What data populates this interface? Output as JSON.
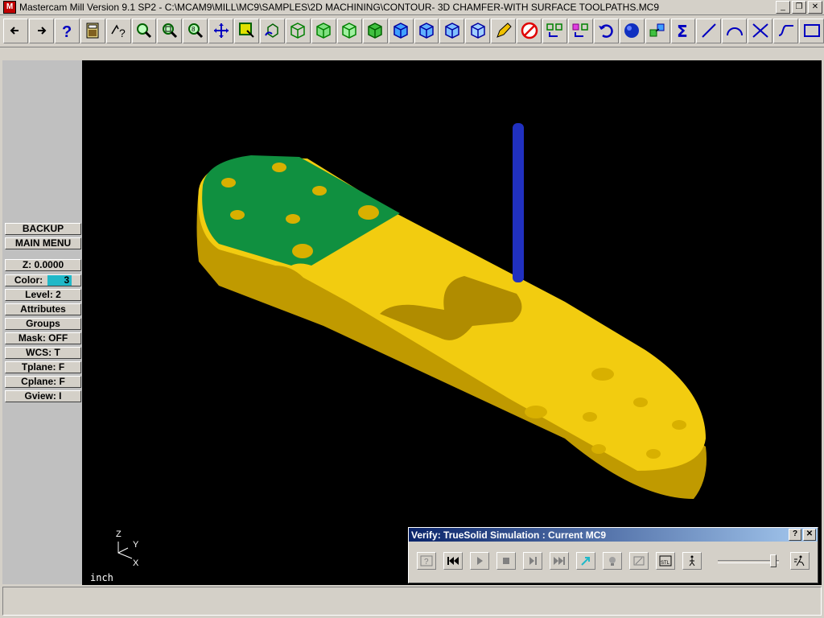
{
  "window": {
    "title": "Mastercam Mill Version 9.1 SP2 - C:\\MCAM9\\MILL\\MC9\\SAMPLES\\2D MACHINING\\CONTOUR- 3D CHAMFER-WITH SURFACE TOOLPATHS.MC9",
    "minimize": "_",
    "restore": "❐",
    "close": "✕"
  },
  "toolbar": {
    "items": [
      "back-arrow",
      "forward-arrow",
      "help",
      "calculator",
      "analyze",
      "zoom",
      "zoom-window",
      "zoom-out",
      "pan",
      "select",
      "rotate",
      "view-top",
      "view-front",
      "view-side",
      "view-iso",
      "view-solid1",
      "view-solid2",
      "view-solid3",
      "view-solid4",
      "pencil",
      "no-entry",
      "transform-1",
      "transform-2",
      "undo",
      "shade-sphere",
      "group",
      "sum",
      "line",
      "arc",
      "fillet",
      "spline",
      "rectangle"
    ]
  },
  "left_menu": {
    "backup": "BACKUP",
    "main_menu": "MAIN MENU",
    "z_value": "Z:  0.0000",
    "color_label": "Color:",
    "color_value": "3",
    "level": "Level:  2",
    "attributes": "Attributes",
    "groups": "Groups",
    "mask": "Mask:  OFF",
    "wcs": "WCS:   T",
    "tplane": "Tplane:  F",
    "cplane": "Cplane:  F",
    "gview": "Gview:   I"
  },
  "viewport": {
    "units": "inch",
    "axis_z": "Z",
    "axis_y": "Y",
    "axis_x": "X"
  },
  "verify": {
    "title": "Verify: TrueSolid Simulation : Current MC9",
    "help": "?",
    "close": "✕",
    "tools": [
      "options",
      "rewind",
      "play",
      "stop",
      "step",
      "fast-forward",
      "tool-display",
      "light-bulb",
      "zoom-part",
      "stl-save",
      "walk"
    ],
    "speed_slider": 0.9
  },
  "colors": {
    "part_yellow": "#f0c800",
    "part_shadow": "#c09a00",
    "top_green": "#109040",
    "tool_blue": "#2030c0"
  }
}
